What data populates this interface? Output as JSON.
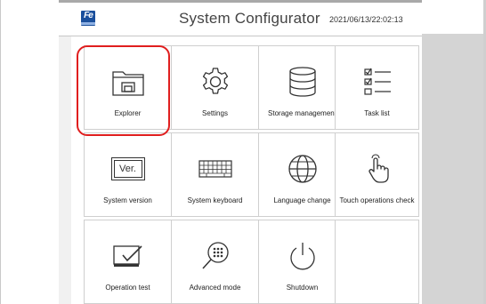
{
  "header": {
    "title": "System Configurator",
    "timestamp": "2021/06/13/22:02:13",
    "logo_text": "Fe"
  },
  "tiles": [
    {
      "label": "Explorer",
      "icon": "folder-icon"
    },
    {
      "label": "Settings",
      "icon": "gear-icon"
    },
    {
      "label": "Storage management",
      "icon": "database-icon"
    },
    {
      "label": "Task list",
      "icon": "checklist-icon"
    },
    {
      "label": "System version",
      "icon": "version-icon",
      "icon_text": "Ver."
    },
    {
      "label": "System keyboard",
      "icon": "keyboard-icon"
    },
    {
      "label": "Language change",
      "icon": "globe-icon"
    },
    {
      "label": "Touch operations check",
      "icon": "touch-hand-icon"
    },
    {
      "label": "Operation test",
      "icon": "operation-test-icon"
    },
    {
      "label": "Advanced mode",
      "icon": "advanced-mode-icon"
    },
    {
      "label": "Shutdown",
      "icon": "power-icon"
    },
    {
      "label": "",
      "icon": ""
    }
  ],
  "colors": {
    "highlight": "#e01e1e",
    "logo": "#1a4f9c",
    "side_panel": "#d4d4d4"
  }
}
